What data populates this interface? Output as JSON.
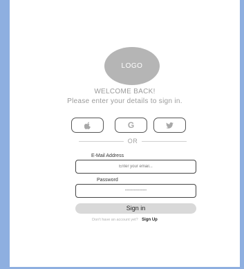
{
  "logo": {
    "text": "LOGO"
  },
  "header": {
    "welcome": "WELCOME BACK!",
    "subtitle": "Please enter your details to sign in."
  },
  "social": [
    {
      "icon": "apple-icon"
    },
    {
      "icon": "google-icon",
      "letter": "G"
    },
    {
      "icon": "twitter-icon"
    }
  ],
  "divider": {
    "text": "OR"
  },
  "form": {
    "email_label": "E-Mail Address",
    "email_placeholder": "Enter your email...",
    "password_label": "Password",
    "password_value": "•••••••••••••••",
    "signin_label": "Sign in"
  },
  "footer": {
    "prompt": "Don't have an account yet?",
    "signup_label": "Sign Up"
  },
  "colors": {
    "background": "#8eafe0",
    "logo": "#b5b5b5",
    "button": "#d9d9d9"
  }
}
